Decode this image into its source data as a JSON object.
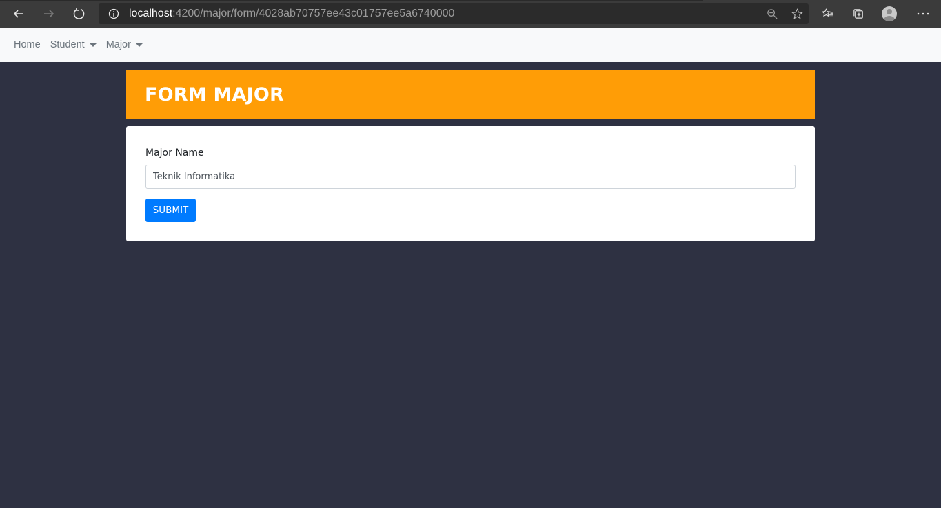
{
  "browser": {
    "url_host": "localhost",
    "url_path": ":4200/major/form/4028ab70757ee43c01757ee5a6740000"
  },
  "navbar": {
    "items": [
      {
        "label": "Home",
        "dropdown": false
      },
      {
        "label": "Student",
        "dropdown": true
      },
      {
        "label": "Major",
        "dropdown": true
      }
    ]
  },
  "header": {
    "title": "FORM MAJOR"
  },
  "form": {
    "major_name_label": "Major Name",
    "major_name_value": "Teknik Informatika",
    "submit_label": "SUBMIT"
  },
  "colors": {
    "header_bg": "#ff9d06",
    "page_bg": "#2e3142",
    "submit_bg": "#007bff"
  }
}
